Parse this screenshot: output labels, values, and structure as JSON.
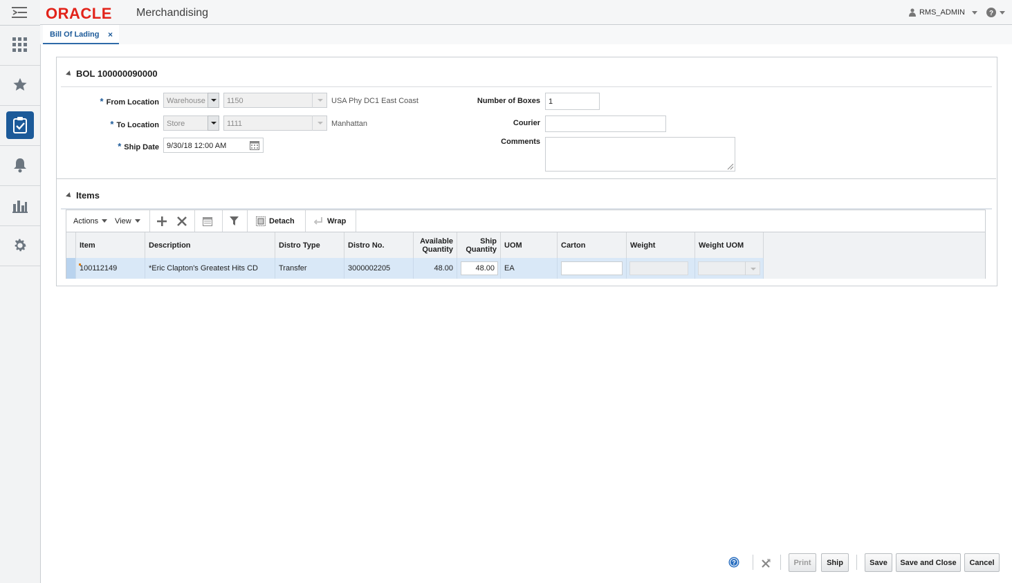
{
  "header": {
    "logo": "ORACLE",
    "app_name": "Merchandising",
    "user": "RMS_ADMIN"
  },
  "tab": {
    "label": "Bill Of Lading",
    "close": "×"
  },
  "bol": {
    "section_title": "BOL 100000090000",
    "from_location": {
      "label": "From Location",
      "type": "Warehouse",
      "id": "1150",
      "desc": "USA Phy DC1 East Coast"
    },
    "to_location": {
      "label": "To Location",
      "type": "Store",
      "id": "1111",
      "desc": "Manhattan"
    },
    "ship_date": {
      "label": "Ship Date",
      "value": "9/30/18 12:00 AM"
    },
    "number_of_boxes": {
      "label": "Number of Boxes",
      "value": "1"
    },
    "courier": {
      "label": "Courier",
      "value": ""
    },
    "comments": {
      "label": "Comments",
      "value": ""
    },
    "required_mark": "*"
  },
  "items": {
    "section_title": "Items",
    "toolbar": {
      "actions": "Actions",
      "view": "View",
      "detach": "Detach",
      "wrap": "Wrap"
    },
    "columns": [
      "Item",
      "Description",
      "Distro Type",
      "Distro No.",
      "Available Quantity",
      "Ship Quantity",
      "UOM",
      "Carton",
      "Weight",
      "Weight UOM"
    ],
    "rows": [
      {
        "item": "100112149",
        "description": "*Eric Clapton's Greatest Hits CD",
        "distro_type": "Transfer",
        "distro_no": "3000002205",
        "available_qty": "48.00",
        "ship_qty": "48.00",
        "uom": "EA",
        "carton": "",
        "weight": "",
        "weight_uom": ""
      }
    ]
  },
  "footer": {
    "print": "Print",
    "ship": "Ship",
    "save": "Save",
    "save_close": "Save and Close",
    "cancel": "Cancel"
  },
  "colors": {
    "brand_red": "#e2231a",
    "accent_blue": "#1c5a99",
    "row_selected": "#d9e8f7"
  }
}
